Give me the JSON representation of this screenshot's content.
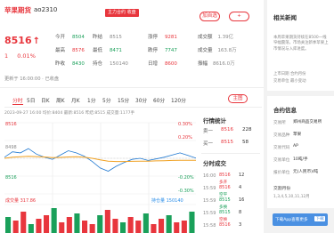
{
  "header": {
    "title": "苹果期货",
    "code": "ao2310",
    "market_badge": "主力合约 收盘",
    "add_button": "加自选",
    "more_button": "+"
  },
  "quote": {
    "price": "8516",
    "arrow": "↑",
    "change": "1",
    "change_pct": "0.01%",
    "update_time": "更新于 16:00:00 · 已收盘",
    "fields": [
      {
        "label": "今开",
        "value": "8504",
        "color": "green"
      },
      {
        "label": "昨结",
        "value": "8515",
        "color": "gray"
      },
      {
        "label": "涨停",
        "value": "9281",
        "color": "red"
      },
      {
        "label": "成交额",
        "value": "1.39亿",
        "color": "gray"
      },
      {
        "label": "最高",
        "value": "8576",
        "color": "red"
      },
      {
        "label": "最低",
        "value": "8471",
        "color": "green"
      },
      {
        "label": "跌停",
        "value": "7747",
        "color": "green"
      },
      {
        "label": "成交量",
        "value": "163.8万",
        "color": "gray"
      },
      {
        "label": "昨收",
        "value": "8430",
        "color": "green"
      },
      {
        "label": "持仓",
        "value": "150140",
        "color": "gray"
      },
      {
        "label": "日增",
        "value": "8600",
        "color": "red"
      },
      {
        "label": "振幅",
        "value": "8616.0万",
        "color": "gray"
      }
    ]
  },
  "chart_tabs": [
    "分时",
    "5日",
    "日K",
    "周K",
    "月K",
    "1分",
    "5分",
    "15分",
    "30分",
    "60分",
    "120分"
  ],
  "chart_button": "主图",
  "chart_info": "2023-09-27 16:00 均价:8404 最新:8516 昨结:8515 成交量:1177手",
  "chart_data": {
    "type": "line",
    "ylim": [
      8350,
      8680
    ],
    "y_tick_labels": [
      "8516",
      "8498",
      "8516"
    ],
    "right_tick_labels": [
      "0.30%",
      "0.20%",
      "-0.20%",
      "-0.30%"
    ],
    "volume_label": "成交量 317.86",
    "volume_right_label": "持仓量 150140",
    "series": [
      {
        "values": [
          8520,
          8545,
          8540,
          8560,
          8535,
          8520,
          8510,
          8530,
          8550,
          8540,
          8525,
          8500,
          8470,
          8455,
          8478,
          8495,
          8510,
          8515,
          8505,
          8512,
          8520,
          8530,
          8540,
          8528,
          8516
        ]
      },
      {
        "values": [
          8515,
          8520,
          8522,
          8524,
          8523,
          8521,
          8518,
          8519,
          8521,
          8522,
          8520,
          8515,
          8508,
          8502,
          8500,
          8500,
          8501,
          8502,
          8502,
          8503,
          8504,
          8505,
          8506,
          8506,
          8506
        ]
      }
    ],
    "volume": [
      9,
      7,
      12,
      5,
      8,
      10,
      14,
      6,
      9,
      11,
      7,
      5,
      10,
      13,
      8,
      6,
      9,
      7,
      11,
      5,
      8,
      10,
      6,
      7,
      12
    ]
  },
  "order_book": {
    "title": "行情统计",
    "rows": [
      {
        "side": "卖一",
        "price": "8516",
        "vol": "228"
      },
      {
        "side": "买一",
        "price": "8515",
        "vol": "58"
      }
    ]
  },
  "ticks": {
    "title": "分时成交",
    "rows": [
      {
        "time": "16:00",
        "price": "8516",
        "vol": "12"
      },
      {
        "time": "15:59",
        "price": "8516",
        "vol": "4"
      },
      {
        "time": "15:59",
        "price": "8515",
        "vol": "16"
      },
      {
        "time": "15:59",
        "price": "8515",
        "vol": "8"
      },
      {
        "time": "15:58",
        "price": "8516",
        "vol": "3"
      }
    ],
    "colors": [
      "red",
      "red",
      "green",
      "green",
      "red"
    ],
    "flags": [
      "多开",
      "空平",
      "多换",
      "空换",
      "多开"
    ]
  },
  "sidebar": {
    "title": "相关新闻",
    "body": "本周苹果期货持续在8500一线窄幅震荡，市场关注新季苹果上市情况与入库进度。",
    "desc2": "上市日期 合约月份",
    "desc3": "交易单位 最小变动",
    "subtitle": "合约信息",
    "rows": [
      {
        "k": "交易所",
        "v": "郑州商品交易所"
      },
      {
        "k": "交易品种",
        "v": "苹果"
      },
      {
        "k": "交易代码",
        "v": "AP"
      },
      {
        "k": "交易单位",
        "v": "10吨/手"
      },
      {
        "k": "报价单位",
        "v": "元(人民币)/吨"
      }
    ],
    "extra": "交割月份",
    "extra2": "1,3,4,5,10,11,12月",
    "promo": "下载App查看更多",
    "promo_btn": "下载"
  }
}
